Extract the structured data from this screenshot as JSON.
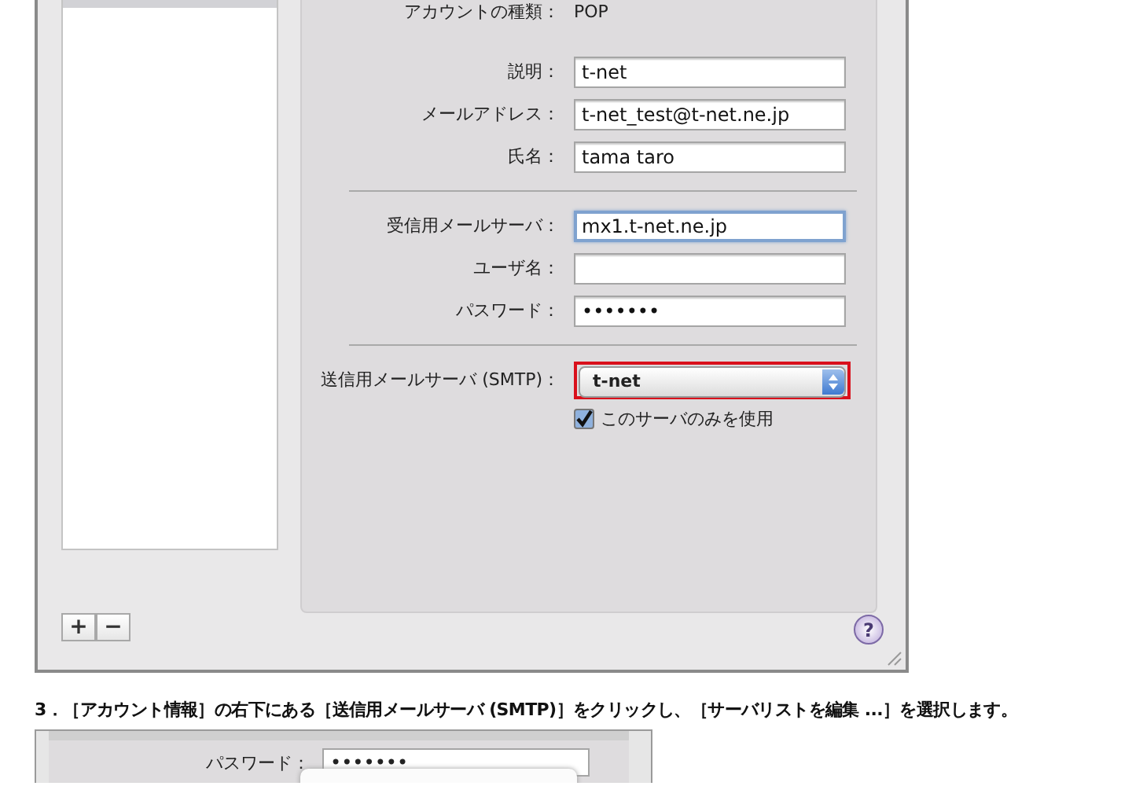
{
  "account_window": {
    "sidebar": {
      "buttons": [
        {
          "label": "+"
        },
        {
          "label": "−"
        }
      ]
    },
    "groups": [
      {
        "rows": [
          {
            "kind": "text",
            "label": "アカウントの種類：",
            "value": "POP"
          }
        ]
      },
      {
        "rows": [
          {
            "kind": "field",
            "label": "説明：",
            "value": "t-net",
            "focused": false
          },
          {
            "kind": "field",
            "label": "メールアドレス：",
            "value": "t-net_test@t-net.ne.jp",
            "focused": false
          },
          {
            "kind": "field",
            "label": "氏名：",
            "value": "tama taro",
            "focused": false
          }
        ]
      },
      {
        "rows": [
          {
            "kind": "field",
            "label": "受信用メールサーバ：",
            "value": "mx1.t-net.ne.jp",
            "focused": true
          },
          {
            "kind": "field",
            "label": "ユーザ名：",
            "value": "",
            "focused": false
          },
          {
            "kind": "field",
            "label": "パスワード：",
            "value": "•••••••",
            "focused": false
          }
        ]
      },
      {
        "rows": [
          {
            "kind": "popup",
            "label": "送信用メールサーバ (SMTP)：",
            "value": "t-net",
            "highlighted": true
          },
          {
            "kind": "checkbox",
            "label": "このサーバのみを使用",
            "checked": true
          }
        ]
      }
    ],
    "help": "?"
  },
  "instruction": "3．［アカウント情報］の右下にある［送信用メールサーバ (SMTP)］をクリックし、［サーバリストを編集 ...］を選択します。",
  "second_screenshot": {
    "label": "パスワード：",
    "value": "•••••••"
  }
}
